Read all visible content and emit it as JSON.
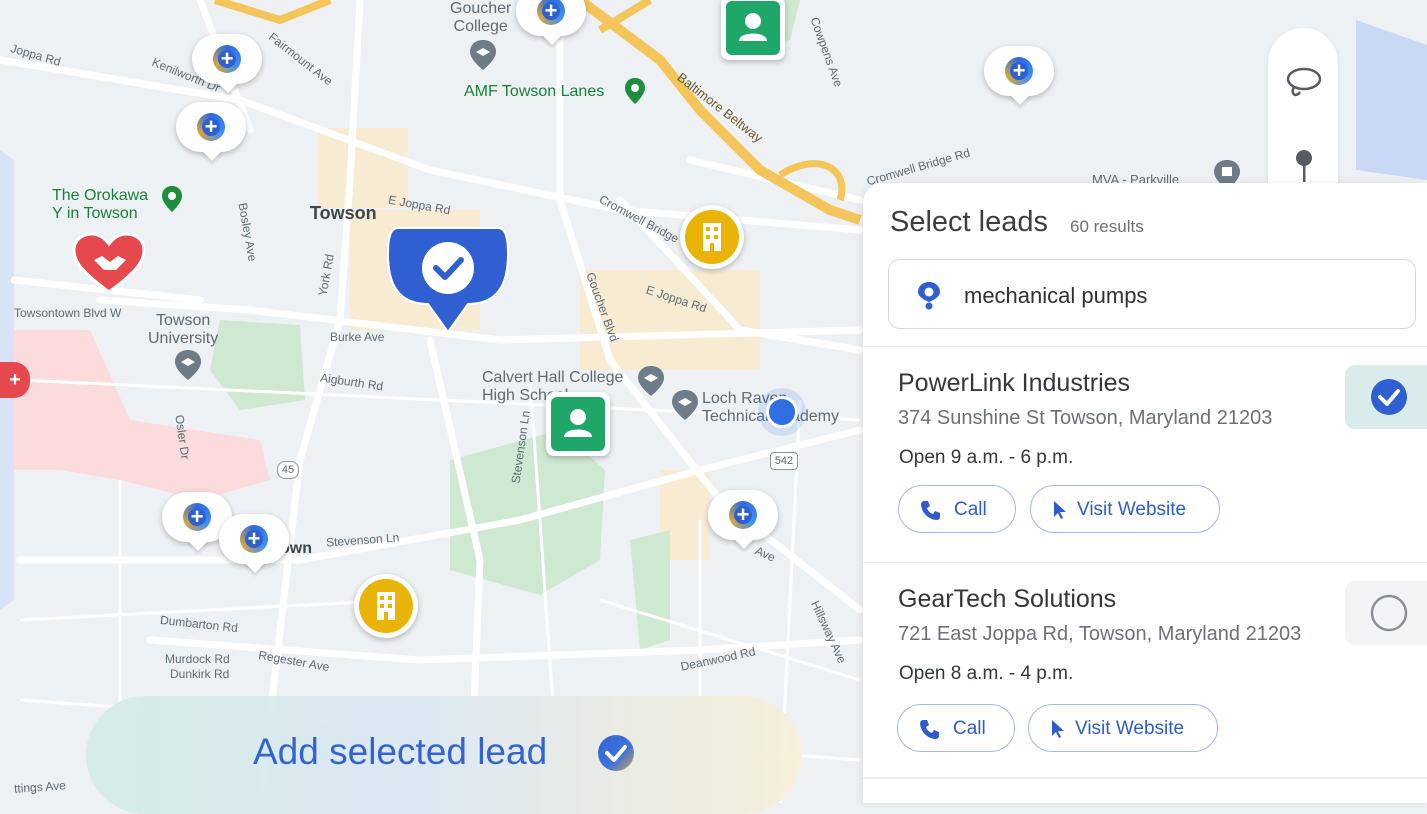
{
  "map": {
    "labels": {
      "goucher_college": "Goucher\nCollege",
      "amf_towson_lanes": "AMF Towson Lanes",
      "baltimore_beltway": "Baltimore Beltway",
      "the_orokawa": "The Orokawa\nY in Towson",
      "towson": "Towson",
      "towson_university": "Towson\nUniversity",
      "calvert_hall": "Calvert Hall College\nHigh School",
      "loch_raven": "Loch Raven\nTechnical Academy",
      "mva_parkville": "MVA - Parkville",
      "e_joppa_rd": "E Joppa Rd",
      "e_joppa_rd_2": "E Joppa Rd",
      "cromwell_bridge_rd": "Cromwell Bridge Rd",
      "cromwell_bridge": "Cromwell Bridge",
      "burke_ave": "Burke Ave",
      "aigburth_rd": "Aigburth Rd",
      "york_rd": "York Rd",
      "bosley_ave": "Bosley Ave",
      "goucher_blvd": "Goucher Blvd",
      "stevenson_ln": "Stevenson Ln",
      "stevenson_ln_2": "Stevenson Ln",
      "dumbarton_rd": "Dumbarton Rd",
      "murdock_rd": "Murdock Rd",
      "dunkirk_rd": "Dunkirk Rd",
      "regester_ave": "Regester Ave",
      "deanwood_rd": "Deanwood Rd",
      "hillsway_ave": "Hillsway Ave",
      "osler_dr": "Osler Dr",
      "kenilworth_dr": "Kenilworth Dr",
      "fairmount_ave": "Fairmount Ave",
      "cowpens_ave": "Cowpens Ave",
      "joppa_rd_left": "Joppa Rd",
      "towsontown_blvd_w": "Towsontown Blvd W",
      "route_45": "45",
      "route_542": "542",
      "town": "own",
      "ave": "Ave",
      "ings_ave": "ttings Ave"
    }
  },
  "panel": {
    "title": "Select leads",
    "count": "60 results",
    "search_value": "mechanical pumps",
    "leads": [
      {
        "name": "PowerLink Industries",
        "address": "374 Sunshine St Towson, Maryland 21203",
        "hours": "Open 9 a.m. - 6 p.m.",
        "call_label": "Call",
        "website_label": "Visit Website",
        "selected": true
      },
      {
        "name": "GearTech Solutions",
        "address": "721 East Joppa Rd, Towson, Maryland 21203",
        "hours": "Open 8 a.m. - 4 p.m.",
        "call_label": "Call",
        "website_label": "Visit Website",
        "selected": false
      }
    ]
  },
  "add_bar": {
    "label": "Add selected lead"
  },
  "colors": {
    "accent_blue": "#2f5fd0",
    "lead_green": "#1fa76a",
    "building_yellow": "#eab308",
    "heart_red": "#e5484d"
  }
}
